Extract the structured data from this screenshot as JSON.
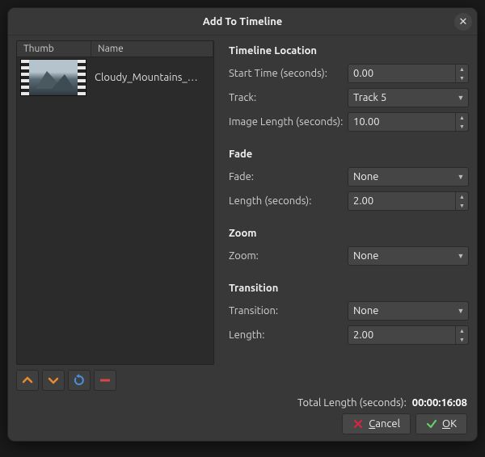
{
  "window": {
    "title": "Add To Timeline"
  },
  "list": {
    "header_thumb": "Thumb",
    "header_name": "Name",
    "items": [
      {
        "name": "Cloudy_Mountains_…"
      }
    ]
  },
  "toolbar_icons": {
    "up": "move-up-icon",
    "down": "move-down-icon",
    "shuffle": "shuffle-icon",
    "remove": "remove-icon"
  },
  "sections": {
    "timeline_location": {
      "title": "Timeline Location",
      "start_time_label": "Start Time (seconds):",
      "start_time_value": "0.00",
      "track_label": "Track:",
      "track_value": "Track 5",
      "image_length_label": "Image Length (seconds):",
      "image_length_value": "10.00"
    },
    "fade": {
      "title": "Fade",
      "fade_label": "Fade:",
      "fade_value": "None",
      "length_label": "Length (seconds):",
      "length_value": "2.00"
    },
    "zoom": {
      "title": "Zoom",
      "zoom_label": "Zoom:",
      "zoom_value": "None"
    },
    "transition": {
      "title": "Transition",
      "transition_label": "Transition:",
      "transition_value": "None",
      "length_label": "Length:",
      "length_value": "2.00"
    }
  },
  "footer": {
    "total_label": "Total Length (seconds):",
    "total_value": "00:00:16:08",
    "cancel": "Cancel",
    "ok": "OK"
  }
}
